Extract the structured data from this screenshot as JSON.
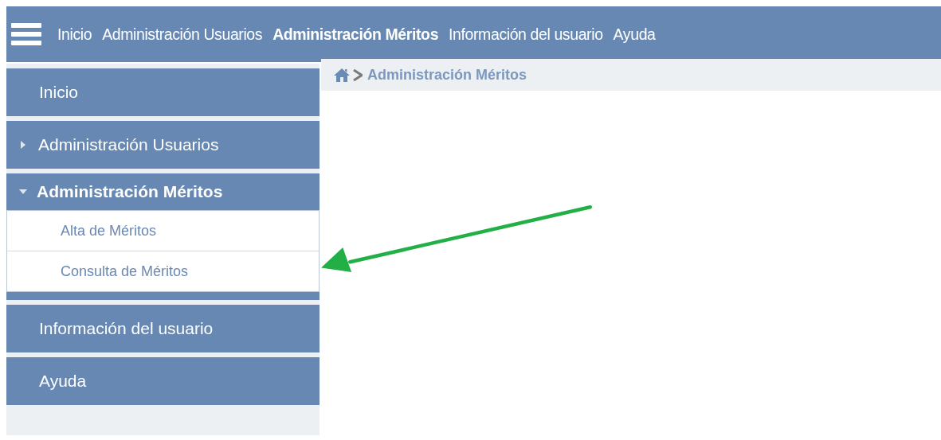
{
  "top_nav": {
    "items": [
      {
        "label": "Inicio",
        "selected": false
      },
      {
        "label": "Administración Usuarios",
        "selected": false
      },
      {
        "label": "Administración Méritos",
        "selected": true
      },
      {
        "label": "Información del usuario",
        "selected": false
      },
      {
        "label": "Ayuda",
        "selected": false
      }
    ]
  },
  "sidebar": {
    "items": [
      {
        "kind": "link",
        "label": "Inicio"
      },
      {
        "kind": "group",
        "label": "Administración Usuarios",
        "expanded": false
      },
      {
        "kind": "group",
        "label": "Administración Méritos",
        "expanded": true,
        "children": [
          {
            "label": "Alta de Méritos"
          },
          {
            "label": "Consulta de Méritos"
          }
        ]
      },
      {
        "kind": "link",
        "label": "Información del usuario"
      },
      {
        "kind": "link",
        "label": "Ayuda"
      }
    ]
  },
  "breadcrumb": {
    "current": "Administración Méritos"
  }
}
